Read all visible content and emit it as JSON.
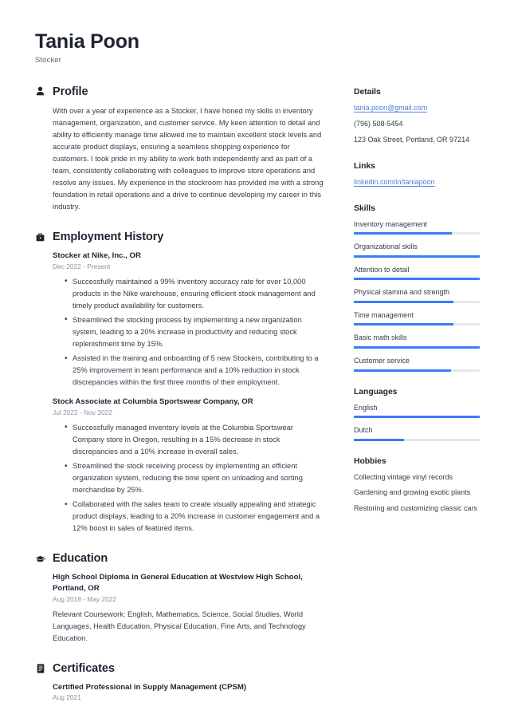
{
  "header": {
    "name": "Tania Poon",
    "title": "Stocker"
  },
  "sections": {
    "profile": {
      "icon": "person-icon",
      "heading": "Profile",
      "text": "With over a year of experience as a Stocker, I have honed my skills in inventory management, organization, and customer service. My keen attention to detail and ability to efficiently manage time allowed me to maintain excellent stock levels and accurate product displays, ensuring a seamless shopping experience for customers. I took pride in my ability to work both independently and as part of a team, consistently collaborating with colleagues to improve store operations and resolve any issues. My experience in the stockroom has provided me with a strong foundation in retail operations and a drive to continue developing my career in this industry."
    },
    "employment": {
      "icon": "briefcase-icon",
      "heading": "Employment History",
      "entries": [
        {
          "title": "Stocker at Nike, Inc., OR",
          "date": "Dec 2022 - Present",
          "bullets": [
            "Successfully maintained a 99% inventory accuracy rate for over 10,000 products in the Nike warehouse, ensuring efficient stock management and timely product availability for customers.",
            "Streamlined the stocking process by implementing a new organization system, leading to a 20% increase in productivity and reducing stock replenishment time by 15%.",
            "Assisted in the training and onboarding of 5 new Stockers, contributing to a 25% improvement in team performance and a 10% reduction in stock discrepancies within the first three months of their employment."
          ]
        },
        {
          "title": "Stock Associate at Columbia Sportswear Company, OR",
          "date": "Jul 2022 - Nov 2022",
          "bullets": [
            "Successfully managed inventory levels at the Columbia Sportswear Company store in Oregon, resulting in a 15% decrease in stock discrepancies and a 10% increase in overall sales.",
            "Streamlined the stock receiving process by implementing an efficient organization system, reducing the time spent on unloading and sorting merchandise by 25%.",
            "Collaborated with the sales team to create visually appealing and strategic product displays, leading to a 20% increase in customer engagement and a 12% boost in sales of featured items."
          ]
        }
      ]
    },
    "education": {
      "icon": "graduation-cap-icon",
      "heading": "Education",
      "entries": [
        {
          "title": "High School Diploma in General Education at Westview High School, Portland, OR",
          "date": "Aug 2018 - May 2022",
          "description": "Relevant Coursework: English, Mathematics, Science, Social Studies, World Languages, Health Education, Physical Education, Fine Arts, and Technology Education."
        }
      ]
    },
    "certificates": {
      "icon": "certificate-icon",
      "heading": "Certificates",
      "entries": [
        {
          "title": "Certified Professional in Supply Management (CPSM)",
          "date": "Aug 2021"
        }
      ]
    }
  },
  "sidebar": {
    "details": {
      "heading": "Details",
      "email": "tania.poon@gmail.com",
      "phone": "(796) 508-5454",
      "address": "123 Oak Street, Portland, OR 97214"
    },
    "links": {
      "heading": "Links",
      "items": [
        {
          "label": "linkedin.com/in/taniapoon"
        }
      ]
    },
    "skills": {
      "heading": "Skills",
      "accent_color": "#3b7df5",
      "track_color": "#e6e8ec",
      "items": [
        {
          "label": "Inventory management",
          "level": 78
        },
        {
          "label": "Organizational skills",
          "level": 100
        },
        {
          "label": "Attention to detail",
          "level": 100
        },
        {
          "label": "Physical stamina and strength",
          "level": 79
        },
        {
          "label": "Time management",
          "level": 79
        },
        {
          "label": "Basic math skills",
          "level": 100
        },
        {
          "label": "Customer service",
          "level": 77
        }
      ]
    },
    "languages": {
      "heading": "Languages",
      "items": [
        {
          "label": "English",
          "level": 100
        },
        {
          "label": "Dutch",
          "level": 40
        }
      ]
    },
    "hobbies": {
      "heading": "Hobbies",
      "items": [
        "Collecting vintage vinyl records",
        "Gardening and growing exotic plants",
        "Restoring and customizing classic cars"
      ]
    }
  }
}
